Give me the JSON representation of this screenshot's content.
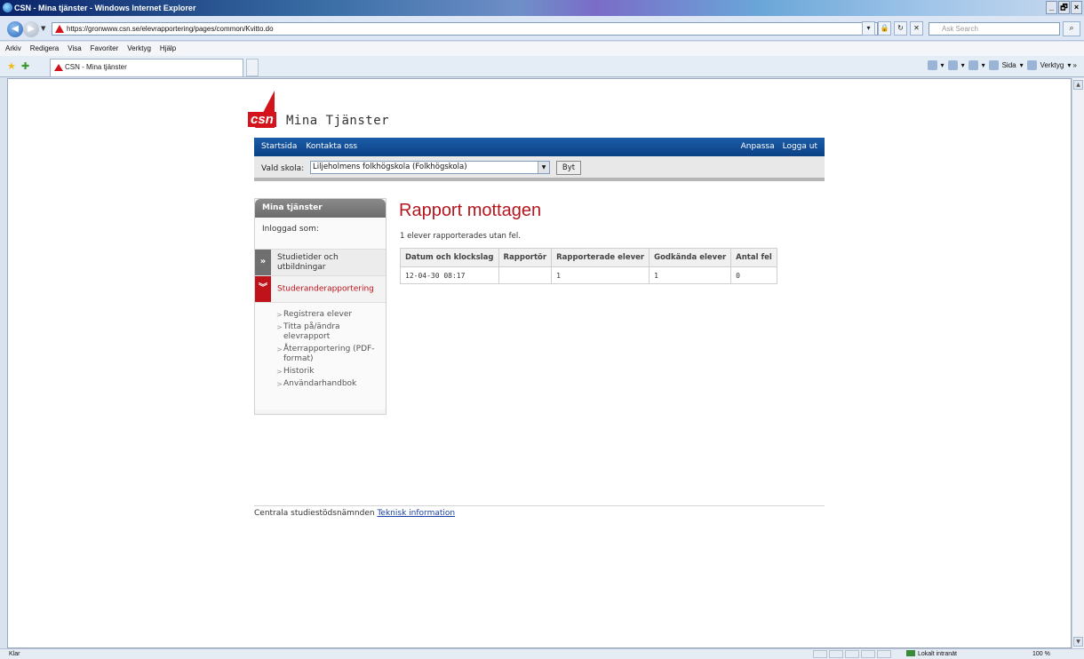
{
  "browser": {
    "title": "CSN - Mina tjänster - Windows Internet Explorer",
    "window_buttons": [
      "_",
      "🗗",
      "×"
    ],
    "url": "https://gronwww.csn.se/elevrapportering/pages/common/Kvitto.do",
    "search_placeholder": "Ask Search",
    "menu": [
      "Arkiv",
      "Redigera",
      "Visa",
      "Favoriter",
      "Verktyg",
      "Hjälp"
    ],
    "tab_title": "CSN - Mina tjänster",
    "commands": {
      "page": "Sida",
      "tools": "Verktyg"
    },
    "status": {
      "text": "Klar",
      "zone": "Lokalt intranät",
      "zoom": "100 %"
    }
  },
  "site": {
    "logo_text": "csn",
    "tagline": "Mina Tjänster",
    "topnav": {
      "left": [
        "Startsida",
        "Kontakta oss"
      ],
      "right": [
        "Anpassa",
        "Logga ut"
      ]
    },
    "school": {
      "label": "Vald skola:",
      "value": "Liljeholmens folkhögskola (Folkhögskola)",
      "button": "Byt"
    }
  },
  "sidebar": {
    "header": "Mina tjänster",
    "logged_in": "Inloggad som:",
    "items": [
      {
        "label": "Studietider och utbildningar",
        "marker": "»",
        "state": "collapsed"
      },
      {
        "label": "Studeranderapportering",
        "marker": "¥",
        "state": "expanded"
      }
    ],
    "sub_items": [
      "Registrera elever",
      "Titta på/ändra elevrapport",
      "Återrapportering (PDF-format)",
      "Historik",
      "Användarhandbok"
    ]
  },
  "main": {
    "title": "Rapport mottagen",
    "info": "1 elever rapporterades utan fel.",
    "table": {
      "headers": [
        "Datum och klockslag",
        "Rapportör",
        "Rapporterade elever",
        "Godkända elever",
        "Antal fel"
      ],
      "rows": [
        [
          "12-04-30 08:17",
          "",
          "1",
          "1",
          "0"
        ]
      ]
    }
  },
  "footer": {
    "text": "Centrala studiestödsnämnden",
    "link": "Teknisk information"
  },
  "colors": {
    "brand_red": "#d4141c",
    "nav_blue": "#0b4185",
    "link_blue": "#1a3fa8"
  }
}
